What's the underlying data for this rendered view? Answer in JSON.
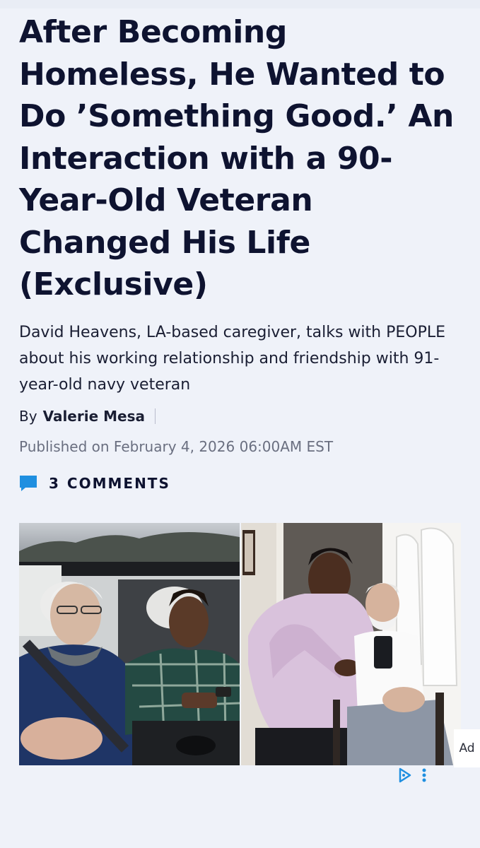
{
  "article": {
    "headline": "After Becoming Homeless, He Wanted to Do ’Something Good.’ An Interaction with a 90-Year-Old Veteran Changed His Life (Exclusive)",
    "dek": "David Heavens, LA-based caregiver, talks with PEOPLE about his working relationship and friendship with 91-year-old navy veteran",
    "byline": {
      "prefix": "By",
      "author": "Valerie Mesa"
    },
    "published": "Published on February 4, 2026 06:00AM EST",
    "comments": {
      "count": "3",
      "label": "COMMENTS"
    }
  },
  "ad": {
    "label": "Ad"
  },
  "icons": {
    "comment": "comment-bubble-icon",
    "adchoices": "adchoices-icon",
    "more": "more-vertical-icon"
  },
  "colors": {
    "background": "#eff2f9",
    "headline": "#0e1330",
    "meta_gray": "#6a6f80",
    "accent_blue": "#1f8fe0"
  }
}
